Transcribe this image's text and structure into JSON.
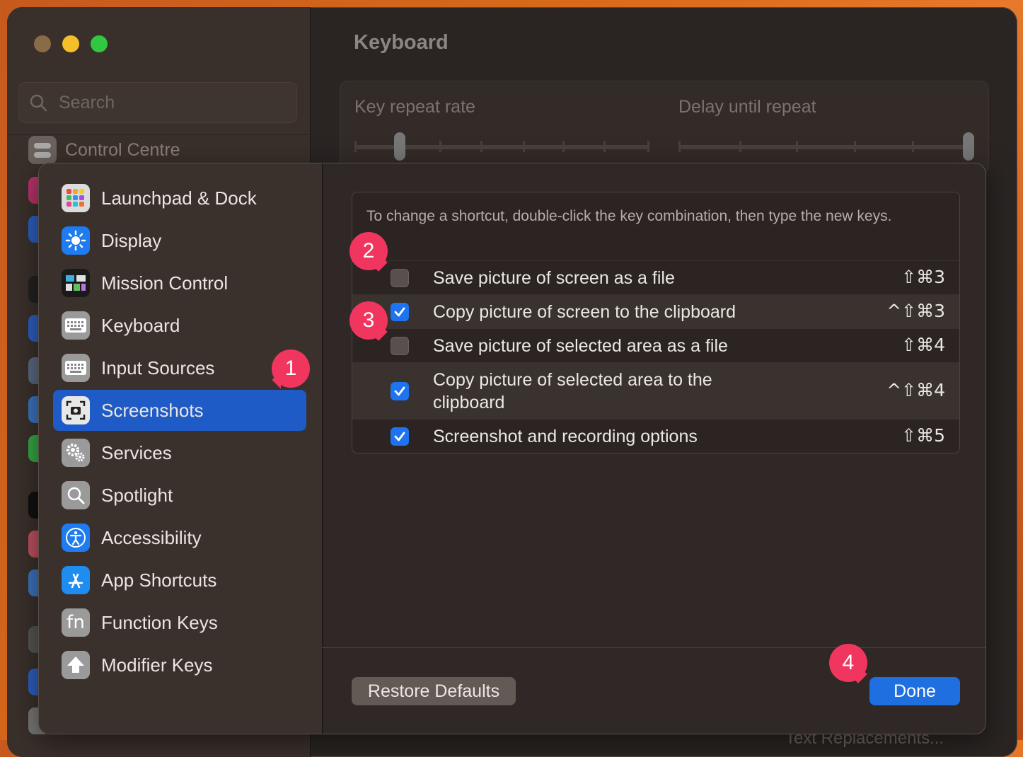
{
  "window": {
    "search_placeholder": "Search",
    "control_centre_label": "Control Centre",
    "title": "Keyboard",
    "key_repeat_label": "Key repeat rate",
    "delay_label": "Delay until repeat",
    "bottom_peek_text": "Text Replacements..."
  },
  "sheet": {
    "nav": [
      {
        "label": "Launchpad & Dock",
        "icon": "launchpad-icon"
      },
      {
        "label": "Display",
        "icon": "display-icon"
      },
      {
        "label": "Mission Control",
        "icon": "mission-control-icon"
      },
      {
        "label": "Keyboard",
        "icon": "keyboard-icon"
      },
      {
        "label": "Input Sources",
        "icon": "input-sources-icon"
      },
      {
        "label": "Screenshots",
        "icon": "screenshots-icon",
        "selected": true
      },
      {
        "label": "Services",
        "icon": "gears-icon"
      },
      {
        "label": "Spotlight",
        "icon": "magnifier-icon"
      },
      {
        "label": "Accessibility",
        "icon": "accessibility-icon"
      },
      {
        "label": "App Shortcuts",
        "icon": "app-store-icon"
      },
      {
        "label": "Function Keys",
        "icon": "fn-icon"
      },
      {
        "label": "Modifier Keys",
        "icon": "modifier-arrow-icon"
      }
    ],
    "hint": "To change a shortcut, double-click the key combination, then type the new keys.",
    "shortcuts": [
      {
        "label": "Save picture of screen as a file",
        "key": "⇧⌘3",
        "checked": false
      },
      {
        "label": "Copy picture of screen to the clipboard",
        "key": "^⇧⌘3",
        "checked": true
      },
      {
        "label": "Save picture of selected area as a file",
        "key": "⇧⌘4",
        "checked": false
      },
      {
        "label": "Copy picture of selected area to the clipboard",
        "key": "^⇧⌘4",
        "checked": true
      },
      {
        "label": "Screenshot and recording options",
        "key": "⇧⌘5",
        "checked": true
      }
    ],
    "restore_label": "Restore Defaults",
    "done_label": "Done"
  },
  "annotations": [
    "1",
    "2",
    "3",
    "4"
  ],
  "colors": {
    "selected": "#1f5bc6",
    "accent": "#1f6fe0",
    "badge": "#f0365e"
  }
}
